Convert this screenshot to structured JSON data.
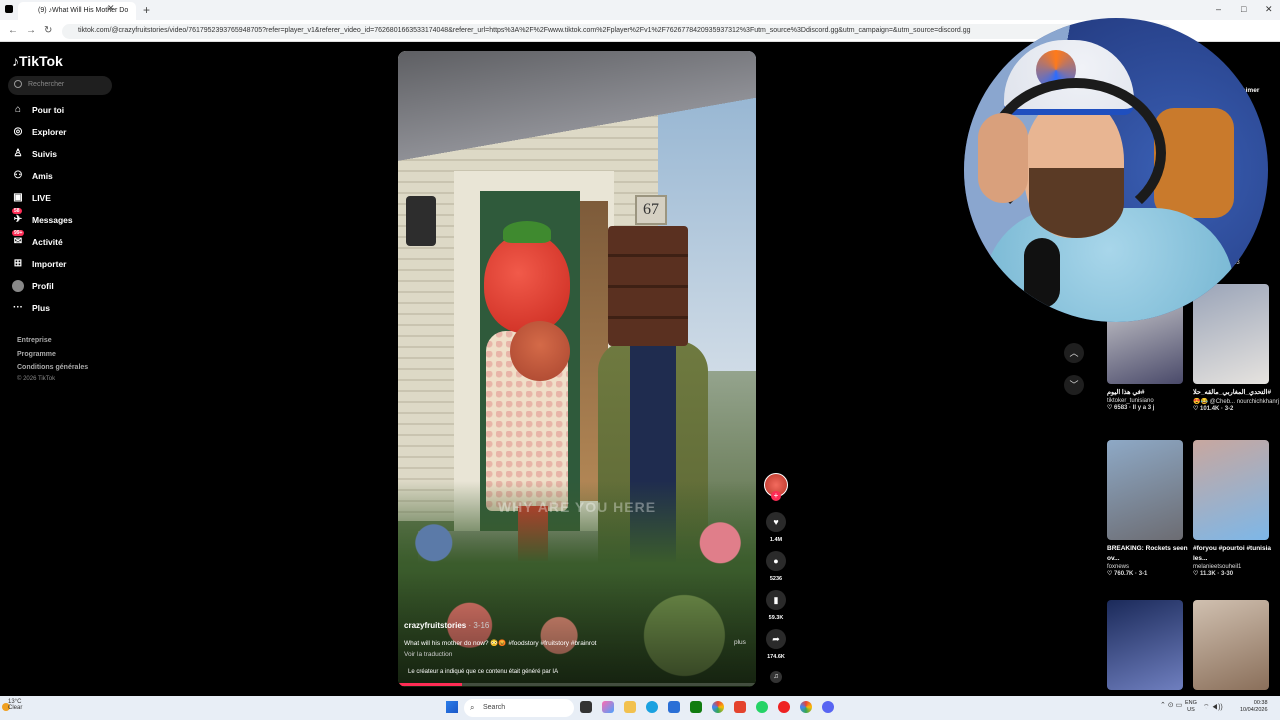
{
  "browser": {
    "tab_title": "(9) ♪What Will His Mother Do",
    "new_tab": "+",
    "url": "tiktok.com/@crazyfruitstories/video/7617952393765948705?refer=player_v1&referer_video_id=7626801663533174048&referer_url=https%3A%2F%2Fwww.tiktok.com%2Fplayer%2Fv1%2F7626778420935937312%3Futm_source%3Ddiscord.gg&utm_campaign=&utm_source=discord.gg"
  },
  "sidebar": {
    "logo": "TikTok",
    "search_placeholder": "Rechercher",
    "items": [
      {
        "label": "Pour toi",
        "icon": "home-icon",
        "glyph": "⌂"
      },
      {
        "label": "Explorer",
        "icon": "compass-icon",
        "glyph": "◎"
      },
      {
        "label": "Suivis",
        "icon": "following-icon",
        "glyph": "♙"
      },
      {
        "label": "Amis",
        "icon": "friends-icon",
        "glyph": "⚇"
      },
      {
        "label": "LIVE",
        "icon": "live-icon",
        "glyph": "▣"
      },
      {
        "label": "Messages",
        "icon": "messages-icon",
        "glyph": "✈",
        "badge": "58"
      },
      {
        "label": "Activité",
        "icon": "activity-icon",
        "glyph": "✉",
        "badge": "99+"
      },
      {
        "label": "Importer",
        "icon": "upload-icon",
        "glyph": "⊞"
      },
      {
        "label": "Profil",
        "icon": "profile-avatar-icon",
        "glyph": "●"
      },
      {
        "label": "Plus",
        "icon": "more-icon",
        "glyph": "···"
      }
    ],
    "footer": [
      "Entreprise",
      "Programme",
      "Conditions générales",
      "© 2026 TikTok"
    ]
  },
  "video": {
    "house_number": "67",
    "subtitle": "WHY ARE YOU HERE",
    "author": "crazyfruitstories",
    "author_date": "· 3-16",
    "caption": "What will his mother do now? 😳😡 #foodstory #fruitstory #brainrot",
    "more": "plus",
    "translate": "Voir la traduction",
    "ai_label": "Le créateur a indiqué que ce contenu était généré par IA",
    "progress": 0.18
  },
  "actions": {
    "like_count": "1.4M",
    "comment_count": "5236",
    "bookmark_count": "59.3K",
    "share_count": "174.6K"
  },
  "right_panel": {
    "videos": [
      {
        "title": "في هذا اليوم#",
        "author": "tiktoker_tunisiano",
        "stats": "♡ 6583 · Il y a 3 j",
        "thumb_colors": [
          "#d8d8d8",
          "#4a4a6a"
        ]
      },
      {
        "title": "التحدي_المغاربي_مالقه_حلا#",
        "author": "😍😂 @Cheb... nourchichkhanrj",
        "stats": "♡ 101.4K · 3-2",
        "thumb_colors": [
          "#9aa4b8",
          "#e6e3df"
        ]
      },
      {
        "title": "BREAKING: Rockets seen ov...",
        "author": "foxnews",
        "stats": "♡ 760.7K · 3-1",
        "thumb_colors": [
          "#8ea9c6",
          "#6c6c72"
        ]
      },
      {
        "title": "#foryou #pourtoi #tunisia les...",
        "author": "melanieetsouheil1",
        "stats": "♡ 11.3K · 3-30",
        "thumb_colors": [
          "#c8a79f",
          "#7db7e8"
        ]
      },
      {
        "title": "",
        "author": "",
        "stats": "",
        "thumb_colors": [
          "#1b2a5a",
          "#6f7fbf"
        ]
      },
      {
        "title": "",
        "author": "",
        "stats": "",
        "thumb_colors": [
          "#d0c0b0",
          "#8a6f5a"
        ]
      }
    ],
    "partial_label": "13",
    "partial_label2": "aimer"
  },
  "taskbar": {
    "weather_temp": "13°C",
    "weather_desc": "Clear",
    "search": "Search",
    "lang_top": "ENG",
    "lang_bottom": "US",
    "time": "00:38",
    "date": "10/04/2026"
  },
  "colors": {
    "accent": "#fe2c55",
    "bg": "#000000"
  }
}
